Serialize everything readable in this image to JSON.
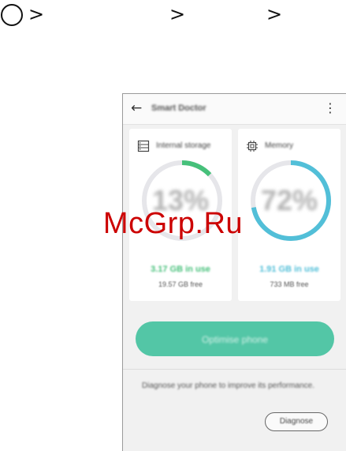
{
  "breadcrumb": {
    "separator": ">"
  },
  "screen": {
    "appbar": {
      "title": "Smart Doctor"
    },
    "storage": {
      "title": "Internal storage",
      "gauge_value": "13%",
      "gauge_fraction": 0.13,
      "in_use": "3.17 GB in use",
      "free": "19.57 GB free",
      "color": "#46c07a"
    },
    "memory": {
      "title": "Memory",
      "gauge_value": "72%",
      "gauge_fraction": 0.72,
      "in_use": "1.91 GB in use",
      "free": "733 MB free",
      "color": "#52bfd8"
    },
    "optimise_label": "Optimise phone",
    "diagnose_text": "Diagnose your phone to improve its performance.",
    "diagnose_label": "Diagnose",
    "accent": "#53c6a6"
  },
  "watermark": "McGrp.Ru"
}
